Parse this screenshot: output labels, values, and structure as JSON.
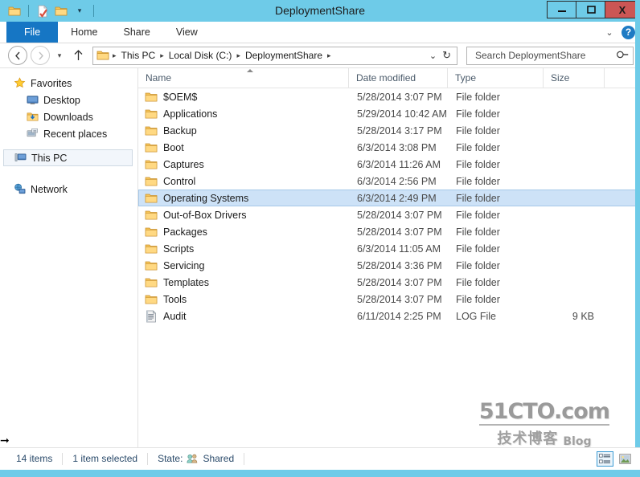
{
  "window": {
    "title": "DeploymentShare",
    "minimize_label": "–",
    "maximize_label": "▭",
    "close_label": "X"
  },
  "quick_access": {
    "items": [
      {
        "name": "folder-icon",
        "label": ""
      },
      {
        "name": "properties-icon",
        "label": ""
      },
      {
        "name": "new-folder-icon",
        "label": ""
      },
      {
        "name": "customize-dropdown-icon",
        "label": "▾"
      }
    ]
  },
  "ribbon": {
    "tabs": [
      {
        "label": "File",
        "id": "file",
        "active": true
      },
      {
        "label": "Home",
        "id": "home",
        "active": false
      },
      {
        "label": "Share",
        "id": "share",
        "active": false
      },
      {
        "label": "View",
        "id": "view",
        "active": false
      }
    ],
    "minimize_ribbon_icon": "⌄",
    "help_label": "?"
  },
  "address_bar": {
    "back_icon": "←",
    "forward_icon": "→",
    "history_icon": "▾",
    "up_icon": "↑",
    "breadcrumbs": [
      {
        "label": "This PC"
      },
      {
        "label": "Local Disk (C:)"
      },
      {
        "label": "DeploymentShare"
      }
    ],
    "separator": "▸",
    "dropdown_icon": "⌄",
    "refresh_icon": "↻"
  },
  "search": {
    "placeholder": "Search DeploymentShare",
    "value": "",
    "icon": "search-icon"
  },
  "sidebar": {
    "groups": [
      {
        "header": {
          "label": "Favorites",
          "icon": "star-icon"
        },
        "items": [
          {
            "label": "Desktop",
            "icon": "desktop-icon"
          },
          {
            "label": "Downloads",
            "icon": "downloads-icon"
          },
          {
            "label": "Recent places",
            "icon": "recent-places-icon"
          }
        ]
      },
      {
        "header": {
          "label": "This PC",
          "icon": "this-pc-icon",
          "selected": true
        },
        "items": []
      },
      {
        "header": {
          "label": "Network",
          "icon": "network-icon"
        },
        "items": []
      }
    ]
  },
  "file_list": {
    "columns": [
      {
        "label": "Name",
        "key": "name"
      },
      {
        "label": "Date modified",
        "key": "date"
      },
      {
        "label": "Type",
        "key": "type"
      },
      {
        "label": "Size",
        "key": "size"
      }
    ],
    "sort": {
      "column": "Name",
      "direction": "ascending"
    },
    "rows": [
      {
        "name": "$OEM$",
        "date": "5/28/2014 3:07 PM",
        "type": "File folder",
        "size": "",
        "icon": "folder-icon",
        "selected": false
      },
      {
        "name": "Applications",
        "date": "5/29/2014 10:42 AM",
        "type": "File folder",
        "size": "",
        "icon": "folder-icon",
        "selected": false
      },
      {
        "name": "Backup",
        "date": "5/28/2014 3:17 PM",
        "type": "File folder",
        "size": "",
        "icon": "folder-icon",
        "selected": false
      },
      {
        "name": "Boot",
        "date": "6/3/2014 3:08 PM",
        "type": "File folder",
        "size": "",
        "icon": "folder-icon",
        "selected": false
      },
      {
        "name": "Captures",
        "date": "6/3/2014 11:26 AM",
        "type": "File folder",
        "size": "",
        "icon": "folder-icon",
        "selected": false
      },
      {
        "name": "Control",
        "date": "6/3/2014 2:56 PM",
        "type": "File folder",
        "size": "",
        "icon": "folder-icon",
        "selected": false
      },
      {
        "name": "Operating Systems",
        "date": "6/3/2014 2:49 PM",
        "type": "File folder",
        "size": "",
        "icon": "folder-icon",
        "selected": true
      },
      {
        "name": "Out-of-Box Drivers",
        "date": "5/28/2014 3:07 PM",
        "type": "File folder",
        "size": "",
        "icon": "folder-icon",
        "selected": false
      },
      {
        "name": "Packages",
        "date": "5/28/2014 3:07 PM",
        "type": "File folder",
        "size": "",
        "icon": "folder-icon",
        "selected": false
      },
      {
        "name": "Scripts",
        "date": "6/3/2014 11:05 AM",
        "type": "File folder",
        "size": "",
        "icon": "folder-icon",
        "selected": false
      },
      {
        "name": "Servicing",
        "date": "5/28/2014 3:36 PM",
        "type": "File folder",
        "size": "",
        "icon": "folder-icon",
        "selected": false
      },
      {
        "name": "Templates",
        "date": "5/28/2014 3:07 PM",
        "type": "File folder",
        "size": "",
        "icon": "folder-icon",
        "selected": false
      },
      {
        "name": "Tools",
        "date": "5/28/2014 3:07 PM",
        "type": "File folder",
        "size": "",
        "icon": "folder-icon",
        "selected": false
      },
      {
        "name": "Audit",
        "date": "6/11/2014 2:25 PM",
        "type": "LOG File",
        "size": "9 KB",
        "icon": "log-file-icon",
        "selected": false
      }
    ]
  },
  "status_bar": {
    "item_count": "14 items",
    "selection": "1 item selected",
    "state_label": "State:",
    "state_value": "Shared",
    "state_icon": "shared-users-icon",
    "views": [
      {
        "name": "details-view-button",
        "active": true
      },
      {
        "name": "large-icons-view-button",
        "active": false
      }
    ]
  },
  "watermark": {
    "line1": "51CTO.com",
    "line2": "技术博客",
    "line3": "Blog"
  },
  "colors": {
    "window_frame": "#6ecbe8",
    "file_tab": "#1676c4",
    "selection": "#cde2f7",
    "close_button": "#cb5655"
  }
}
